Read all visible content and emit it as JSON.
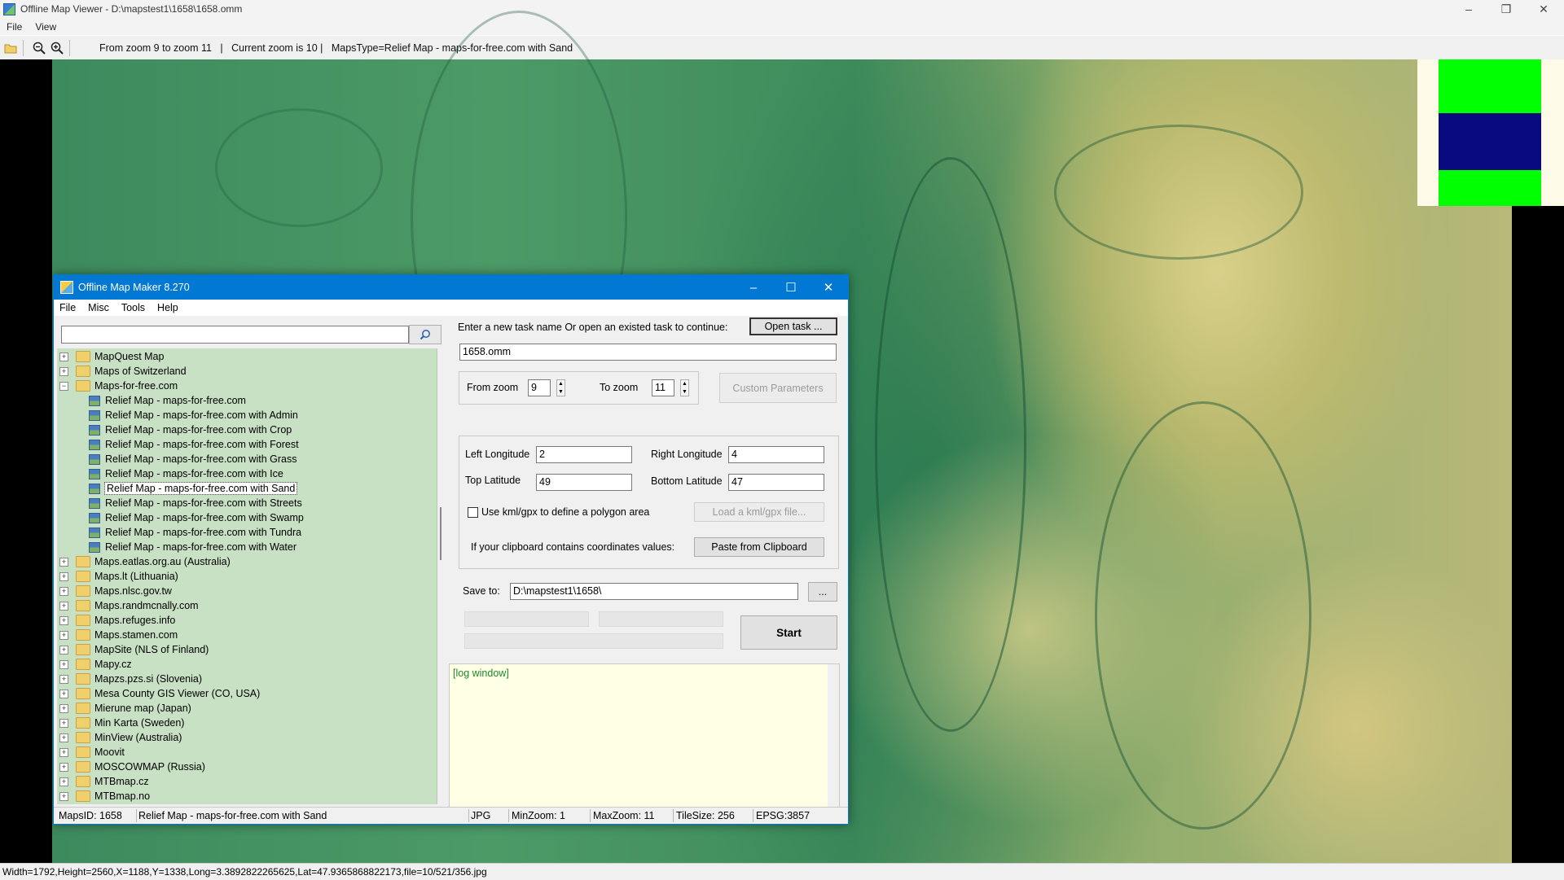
{
  "viewer": {
    "title": "Offline Map Viewer - D:\\mapstest1\\1658\\1658.omm",
    "menu": [
      "File",
      "View"
    ],
    "info": "From zoom 9 to zoom 11   |   Current zoom is 10 |   MapsType=Relief Map - maps-for-free.com with Sand",
    "status": "Width=1792,Height=2560,X=1188,Y=1338,Long=3.3892822265625,Lat=47.9365868822173,file=10/521/356.jpg"
  },
  "maker": {
    "title": "Offline Map Maker 8.270",
    "menu": [
      "File",
      "Misc",
      "Tools",
      "Help"
    ],
    "search_value": "",
    "tree": [
      {
        "label": "MapQuest Map",
        "type": "folder",
        "expanded": false
      },
      {
        "label": "Maps of Switzerland",
        "type": "folder",
        "expanded": false
      },
      {
        "label": "Maps-for-free.com",
        "type": "folder",
        "expanded": true
      },
      {
        "label": "Relief Map - maps-for-free.com",
        "type": "map"
      },
      {
        "label": "Relief Map - maps-for-free.com with Admin",
        "type": "map"
      },
      {
        "label": "Relief Map - maps-for-free.com with Crop",
        "type": "map"
      },
      {
        "label": "Relief Map - maps-for-free.com with Forest",
        "type": "map"
      },
      {
        "label": "Relief Map - maps-for-free.com with Grass",
        "type": "map"
      },
      {
        "label": "Relief Map - maps-for-free.com with Ice",
        "type": "map"
      },
      {
        "label": "Relief Map - maps-for-free.com with Sand",
        "type": "map",
        "selected": true
      },
      {
        "label": "Relief Map - maps-for-free.com with Streets",
        "type": "map"
      },
      {
        "label": "Relief Map - maps-for-free.com with Swamp",
        "type": "map"
      },
      {
        "label": "Relief Map - maps-for-free.com with Tundra",
        "type": "map"
      },
      {
        "label": "Relief Map - maps-for-free.com with Water",
        "type": "map"
      },
      {
        "label": "Maps.eatlas.org.au (Australia)",
        "type": "folder",
        "expanded": false
      },
      {
        "label": "Maps.lt (Lithuania)",
        "type": "folder",
        "expanded": false
      },
      {
        "label": "Maps.nlsc.gov.tw",
        "type": "folder",
        "expanded": false
      },
      {
        "label": "Maps.randmcnally.com",
        "type": "folder",
        "expanded": false
      },
      {
        "label": "Maps.refuges.info",
        "type": "folder",
        "expanded": false
      },
      {
        "label": "Maps.stamen.com",
        "type": "folder",
        "expanded": false
      },
      {
        "label": "MapSite (NLS of Finland)",
        "type": "folder",
        "expanded": false
      },
      {
        "label": "Mapy.cz",
        "type": "folder",
        "expanded": false
      },
      {
        "label": "Mapzs.pzs.si (Slovenia)",
        "type": "folder",
        "expanded": false
      },
      {
        "label": "Mesa County GIS Viewer (CO, USA)",
        "type": "folder",
        "expanded": false
      },
      {
        "label": "Mierune map (Japan)",
        "type": "folder",
        "expanded": false
      },
      {
        "label": "Min Karta (Sweden)",
        "type": "folder",
        "expanded": false
      },
      {
        "label": "MinView (Australia)",
        "type": "folder",
        "expanded": false
      },
      {
        "label": "Moovit",
        "type": "folder",
        "expanded": false
      },
      {
        "label": "MOSCOWMAP (Russia)",
        "type": "folder",
        "expanded": false
      },
      {
        "label": "MTBmap.cz",
        "type": "folder",
        "expanded": false
      },
      {
        "label": "MTBmap.no",
        "type": "folder",
        "expanded": false
      }
    ],
    "task_prompt": "Enter a new task name Or open an existed task to continue:",
    "open_task": "Open task ...",
    "task_name": "1658.omm",
    "from_zoom_label": "From zoom",
    "from_zoom": "9",
    "to_zoom_label": "To zoom",
    "to_zoom": "11",
    "custom_params": "Custom Parameters",
    "left_lon_label": "Left Longitude",
    "left_lon": "2",
    "right_lon_label": "Right Longitude",
    "right_lon": "4",
    "top_lat_label": "Top Latitude",
    "top_lat": "49",
    "bottom_lat_label": "Bottom Latitude",
    "bottom_lat": "47",
    "kml_label": "Use kml/gpx to define a polygon area",
    "load_kml": "Load a kml/gpx file...",
    "clipboard_label": "If your clipboard contains coordinates values:",
    "paste_clipboard": "Paste from Clipboard",
    "save_label": "Save to:",
    "save_path": "D:\\mapstest1\\1658\\",
    "browse": "...",
    "start": "Start",
    "log": "[log window]",
    "status": {
      "maps_id": "MapsID: 1658",
      "name": "Relief Map - maps-for-free.com with Sand",
      "format": "JPG",
      "min_zoom": "MinZoom: 1",
      "max_zoom": "MaxZoom: 11",
      "tile_size": "TileSize: 256",
      "epsg": "EPSG:3857"
    }
  },
  "colors": {
    "accent": "#0078d4",
    "tree_bg": "#c8e0c4",
    "log_bg": "#ffffe6"
  }
}
